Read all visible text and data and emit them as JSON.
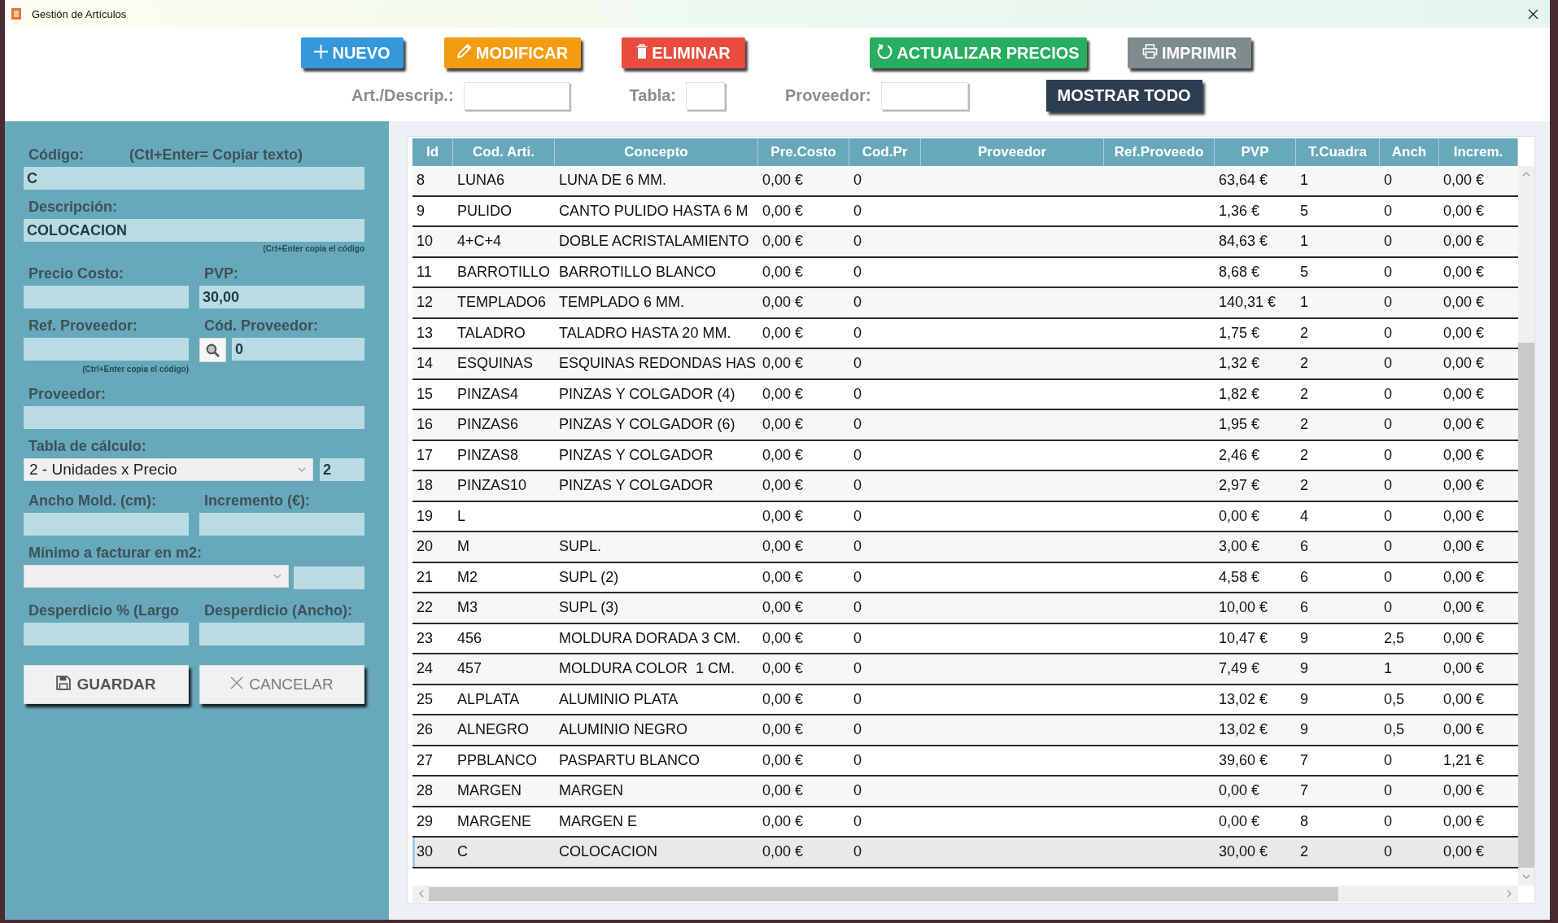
{
  "window": {
    "title": "Gestión de Artículos"
  },
  "toolbar": {
    "buttons": [
      {
        "label": "NUEVO",
        "kind": "new",
        "color": "#3498db"
      },
      {
        "label": "MODIFICAR",
        "kind": "edit",
        "color": "#f39c12"
      },
      {
        "label": "ELIMINAR",
        "kind": "delete",
        "color": "#e74c3c"
      },
      {
        "label": "ACTUALIZAR PRECIOS",
        "kind": "refresh",
        "color": "#27ae60"
      },
      {
        "label": "IMPRIMIR",
        "kind": "print",
        "color": "#7f8c8d"
      }
    ],
    "filters": [
      {
        "label": "Art./Descrip.:"
      },
      {
        "label": "Tabla:"
      },
      {
        "label": "Proveedor:"
      }
    ],
    "show_all_button": "MOSTRAR TODO"
  },
  "form": {
    "code": {
      "label": "Código:",
      "hint": "(Ctl+Enter= Copiar texto)",
      "value": "C"
    },
    "description": {
      "label": "Descripción:",
      "value": "COLOCACION",
      "note": "(Crt+Enter copia el código"
    },
    "cost_price": {
      "label": "Precio Costo:"
    },
    "pvp": {
      "label": "PVP:",
      "value": "30,00"
    },
    "supplier_ref": {
      "label": "Ref. Proveedor:",
      "note": "(Ctrl+Enter copia el código)"
    },
    "supplier_code": {
      "label": "Cód. Proveedor:",
      "value": "0"
    },
    "supplier": {
      "label": "Proveedor:"
    },
    "calc_table": {
      "label": "Tabla de cálculo:",
      "value": "2 - Unidades x Precio",
      "number": "2"
    },
    "molding_width": {
      "label": "Ancho Mold. (cm):"
    },
    "increment": {
      "label": "Incremento (€):"
    },
    "minimum_m2": {
      "label": "Mínimo a facturar en m2:"
    },
    "waste_length": {
      "label": "Desperdicio % (Largo"
    },
    "waste_width": {
      "label": "Desperdicio (Ancho):"
    },
    "buttons": [
      {
        "label": "GUARDAR",
        "kind": "save"
      },
      {
        "label": "CANCELAR",
        "kind": "cancel"
      }
    ]
  },
  "table": {
    "columns": [
      "Id",
      "Cod. Arti.",
      "Concepto",
      "Pre.Costo",
      "Cod.Pr",
      "Proveedor",
      "Ref.Proveedo",
      "PVP",
      "T.Cuadra",
      "Anch",
      "Increm."
    ],
    "rows": [
      {
        "id": "8",
        "cod_arti": "LUNA6",
        "concepto": "LUNA DE 6 MM.",
        "pre_costo": "0,00 €",
        "cod_pr": "0",
        "pvp": "63,64 €",
        "t_cuadra": "1",
        "anch": "0",
        "increm": "0,00 €",
        "selected": false
      },
      {
        "id": "9",
        "cod_arti": "PULIDO",
        "concepto": "CANTO PULIDO HASTA 6 M",
        "pre_costo": "0,00 €",
        "cod_pr": "0",
        "pvp": "1,36 €",
        "t_cuadra": "5",
        "anch": "0",
        "increm": "0,00 €",
        "selected": false
      },
      {
        "id": "10",
        "cod_arti": "4+C+4",
        "concepto": "DOBLE ACRISTALAMIENTO",
        "pre_costo": "0,00 €",
        "cod_pr": "0",
        "pvp": "84,63 €",
        "t_cuadra": "1",
        "anch": "0",
        "increm": "0,00 €",
        "selected": false
      },
      {
        "id": "11",
        "cod_arti": "BARROTILLO",
        "concepto": "BARROTILLO BLANCO",
        "pre_costo": "0,00 €",
        "cod_pr": "0",
        "pvp": "8,68 €",
        "t_cuadra": "5",
        "anch": "0",
        "increm": "0,00 €",
        "selected": false
      },
      {
        "id": "12",
        "cod_arti": "TEMPLADO6",
        "concepto": "TEMPLADO 6 MM.",
        "pre_costo": "0,00 €",
        "cod_pr": "0",
        "pvp": "140,31 €",
        "t_cuadra": "1",
        "anch": "0",
        "increm": "0,00 €",
        "selected": false
      },
      {
        "id": "13",
        "cod_arti": "TALADRO",
        "concepto": "TALADRO HASTA 20 MM.",
        "pre_costo": "0,00 €",
        "cod_pr": "0",
        "pvp": "1,75 €",
        "t_cuadra": "2",
        "anch": "0",
        "increm": "0,00 €",
        "selected": false
      },
      {
        "id": "14",
        "cod_arti": "ESQUINAS",
        "concepto": "ESQUINAS REDONDAS HAS",
        "pre_costo": "0,00 €",
        "cod_pr": "0",
        "pvp": "1,32 €",
        "t_cuadra": "2",
        "anch": "0",
        "increm": "0,00 €",
        "selected": false
      },
      {
        "id": "15",
        "cod_arti": "PINZAS4",
        "concepto": "PINZAS Y COLGADOR (4)",
        "pre_costo": "0,00 €",
        "cod_pr": "0",
        "pvp": "1,82 €",
        "t_cuadra": "2",
        "anch": "0",
        "increm": "0,00 €",
        "selected": false
      },
      {
        "id": "16",
        "cod_arti": "PINZAS6",
        "concepto": "PINZAS Y COLGADOR (6)",
        "pre_costo": "0,00 €",
        "cod_pr": "0",
        "pvp": "1,95 €",
        "t_cuadra": "2",
        "anch": "0",
        "increm": "0,00 €",
        "selected": false
      },
      {
        "id": "17",
        "cod_arti": "PINZAS8",
        "concepto": "PINZAS Y COLGADOR",
        "pre_costo": "0,00 €",
        "cod_pr": "0",
        "pvp": "2,46 €",
        "t_cuadra": "2",
        "anch": "0",
        "increm": "0,00 €",
        "selected": false
      },
      {
        "id": "18",
        "cod_arti": "PINZAS10",
        "concepto": "PINZAS Y COLGADOR",
        "pre_costo": "0,00 €",
        "cod_pr": "0",
        "pvp": "2,97 €",
        "t_cuadra": "2",
        "anch": "0",
        "increm": "0,00 €",
        "selected": false
      },
      {
        "id": "19",
        "cod_arti": "L",
        "pre_costo": "0,00 €",
        "cod_pr": "0",
        "pvp": "0,00 €",
        "t_cuadra": "4",
        "anch": "0",
        "increm": "0,00 €",
        "selected": false
      },
      {
        "id": "20",
        "cod_arti": "M",
        "concepto": "SUPL.",
        "pre_costo": "0,00 €",
        "cod_pr": "0",
        "pvp": "3,00 €",
        "t_cuadra": "6",
        "anch": "0",
        "increm": "0,00 €",
        "selected": false
      },
      {
        "id": "21",
        "cod_arti": "M2",
        "concepto": "SUPL (2)",
        "pre_costo": "0,00 €",
        "cod_pr": "0",
        "pvp": "4,58 €",
        "t_cuadra": "6",
        "anch": "0",
        "increm": "0,00 €",
        "selected": false
      },
      {
        "id": "22",
        "cod_arti": "M3",
        "concepto": "SUPL (3)",
        "pre_costo": "0,00 €",
        "cod_pr": "0",
        "pvp": "10,00 €",
        "t_cuadra": "6",
        "anch": "0",
        "increm": "0,00 €",
        "selected": false
      },
      {
        "id": "23",
        "cod_arti": "456",
        "concepto": "MOLDURA DORADA 3 CM.",
        "pre_costo": "0,00 €",
        "cod_pr": "0",
        "pvp": "10,47 €",
        "t_cuadra": "9",
        "anch": "2,5",
        "increm": "0,00 €",
        "selected": false
      },
      {
        "id": "24",
        "cod_arti": "457",
        "concepto": "MOLDURA COLOR  1 CM.",
        "pre_costo": "0,00 €",
        "cod_pr": "0",
        "pvp": "7,49 €",
        "t_cuadra": "9",
        "anch": "1",
        "increm": "0,00 €",
        "selected": false
      },
      {
        "id": "25",
        "cod_arti": "ALPLATA",
        "concepto": "ALUMINIO PLATA",
        "pre_costo": "0,00 €",
        "cod_pr": "0",
        "pvp": "13,02 €",
        "t_cuadra": "9",
        "anch": "0,5",
        "increm": "0,00 €",
        "selected": false
      },
      {
        "id": "26",
        "cod_arti": "ALNEGRO",
        "concepto": "ALUMINIO NEGRO",
        "pre_costo": "0,00 €",
        "cod_pr": "0",
        "pvp": "13,02 €",
        "t_cuadra": "9",
        "anch": "0,5",
        "increm": "0,00 €",
        "selected": false
      },
      {
        "id": "27",
        "cod_arti": "PPBLANCO",
        "concepto": "PASPARTU BLANCO",
        "pre_costo": "0,00 €",
        "cod_pr": "0",
        "pvp": "39,60 €",
        "t_cuadra": "7",
        "anch": "0",
        "increm": "1,21 €",
        "selected": false
      },
      {
        "id": "28",
        "cod_arti": "MARGEN",
        "concepto": "MARGEN",
        "pre_costo": "0,00 €",
        "cod_pr": "0",
        "pvp": "0,00 €",
        "t_cuadra": "7",
        "anch": "0",
        "increm": "0,00 €",
        "selected": false
      },
      {
        "id": "29",
        "cod_arti": "MARGENE",
        "concepto": "MARGEN E",
        "pre_costo": "0,00 €",
        "cod_pr": "0",
        "pvp": "0,00 €",
        "t_cuadra": "8",
        "anch": "0",
        "increm": "0,00 €",
        "selected": false
      },
      {
        "id": "30",
        "cod_arti": "C",
        "concepto": "COLOCACION",
        "pre_costo": "0,00 €",
        "cod_pr": "0",
        "pvp": "30,00 €",
        "t_cuadra": "2",
        "anch": "0",
        "increm": "0,00 €",
        "selected": true
      }
    ]
  }
}
